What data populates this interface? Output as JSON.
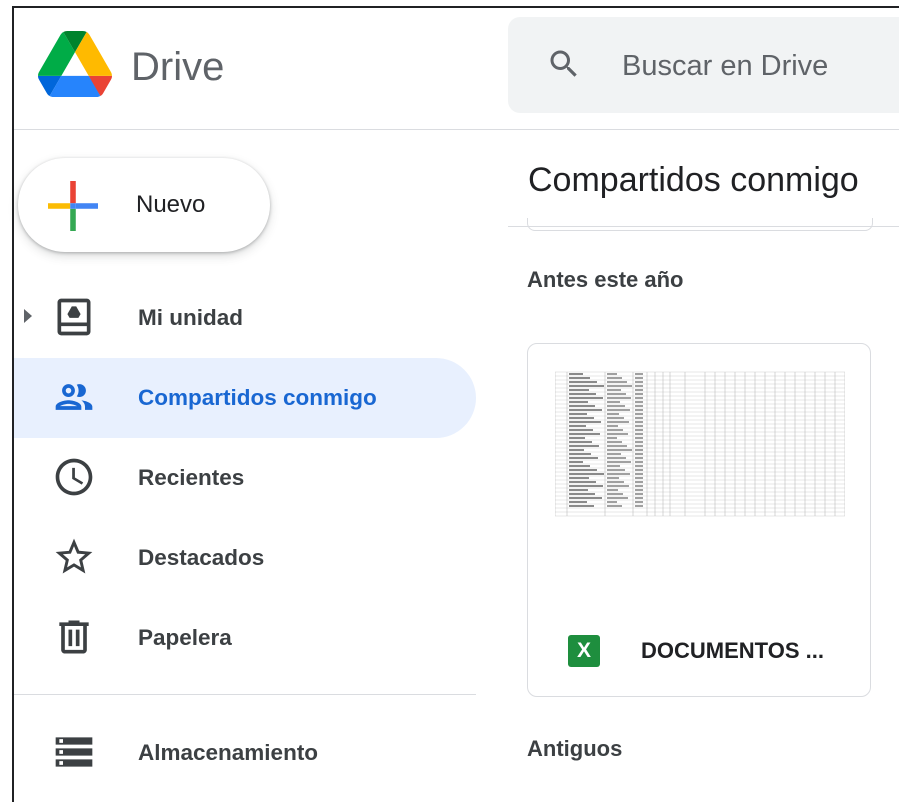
{
  "header": {
    "brand": "Drive",
    "search": {
      "placeholder": "Buscar en Drive"
    }
  },
  "sidebar": {
    "new_button_label": "Nuevo",
    "items": [
      {
        "label": "Mi unidad",
        "icon": "my-drive-icon"
      },
      {
        "label": "Compartidos conmigo",
        "icon": "shared-with-me-icon",
        "active": true
      },
      {
        "label": "Recientes",
        "icon": "clock-icon"
      },
      {
        "label": "Destacados",
        "icon": "star-icon"
      },
      {
        "label": "Papelera",
        "icon": "trash-icon"
      },
      {
        "label": "Almacenamiento",
        "icon": "storage-icon"
      }
    ]
  },
  "main": {
    "title": "Compartidos conmigo",
    "sections": [
      {
        "label": "Antes este año"
      },
      {
        "label": "Antiguos"
      }
    ],
    "files": [
      {
        "name": "DOCUMENTOS ...",
        "type_icon": "X"
      }
    ]
  },
  "colors": {
    "accent": "#1967d2",
    "active_bg": "#e8f0fe",
    "search_bg": "#f1f3f4",
    "sheets_green": "#1e8e3e"
  }
}
